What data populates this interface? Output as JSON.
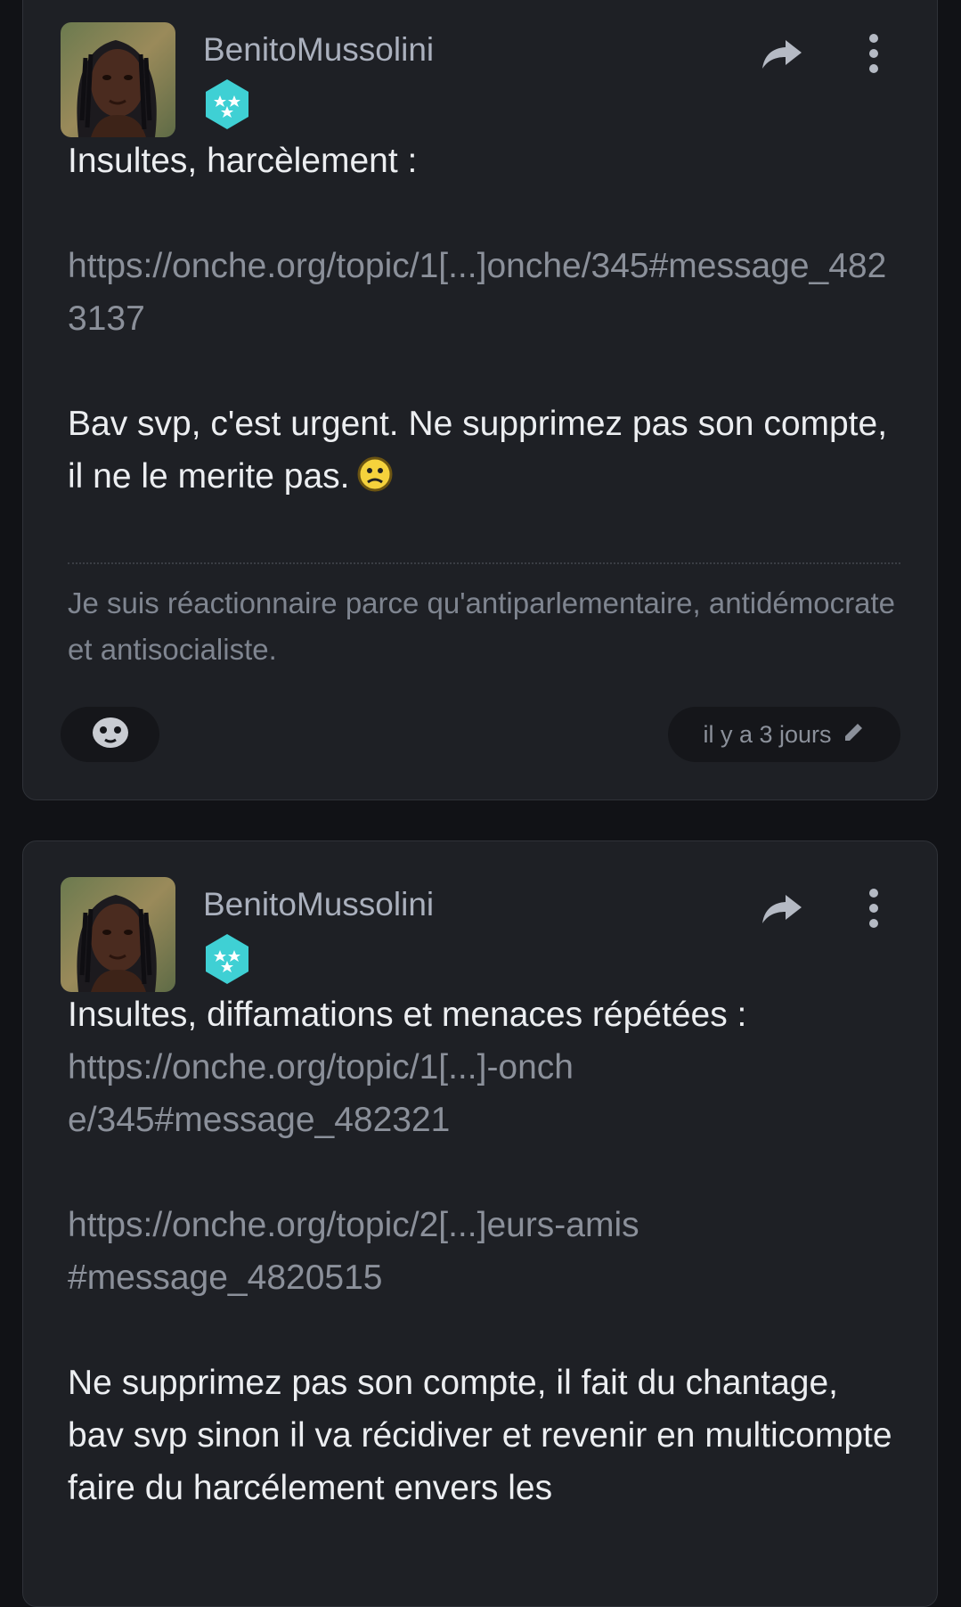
{
  "posts": [
    {
      "username": "BenitoMussolini",
      "title_line": "Insultes, harcèlement :",
      "links": [
        "https://onche.org/topic/1[...]onche/345#message_4823137"
      ],
      "message": "Bav svp, c'est urgent. Ne supprimez pas son compte, il ne le merite pas.",
      "message_emoji": "worried-smiley",
      "signature": "Je suis réactionnaire parce qu'antiparlementaire, antidémocrate et antisocialiste.",
      "timestamp": "il y a 3 jours"
    },
    {
      "username": "BenitoMussolini",
      "title_line": "Insultes, diffamations et menaces répétées :",
      "links": [
        "https://onche.org/topic/1[...]-onche/345#message_482321",
        "https://onche.org/topic/2[...]eurs-amis#message_4820515"
      ],
      "message": "Ne supprimez pas son compte, il fait du chantage, bav svp sinon il va récidiver et revenir en multicompte faire du harcélement envers les"
    }
  ],
  "colors": {
    "background": "#111216",
    "card": "#1e2025",
    "badge": "#3fd0d4",
    "username": "#aab0bd",
    "link": "#8b909a"
  },
  "icons": [
    "share-icon",
    "more-vertical-icon",
    "rank-badge-icon",
    "emoji-reaction-icon",
    "edit-pencil-icon"
  ]
}
